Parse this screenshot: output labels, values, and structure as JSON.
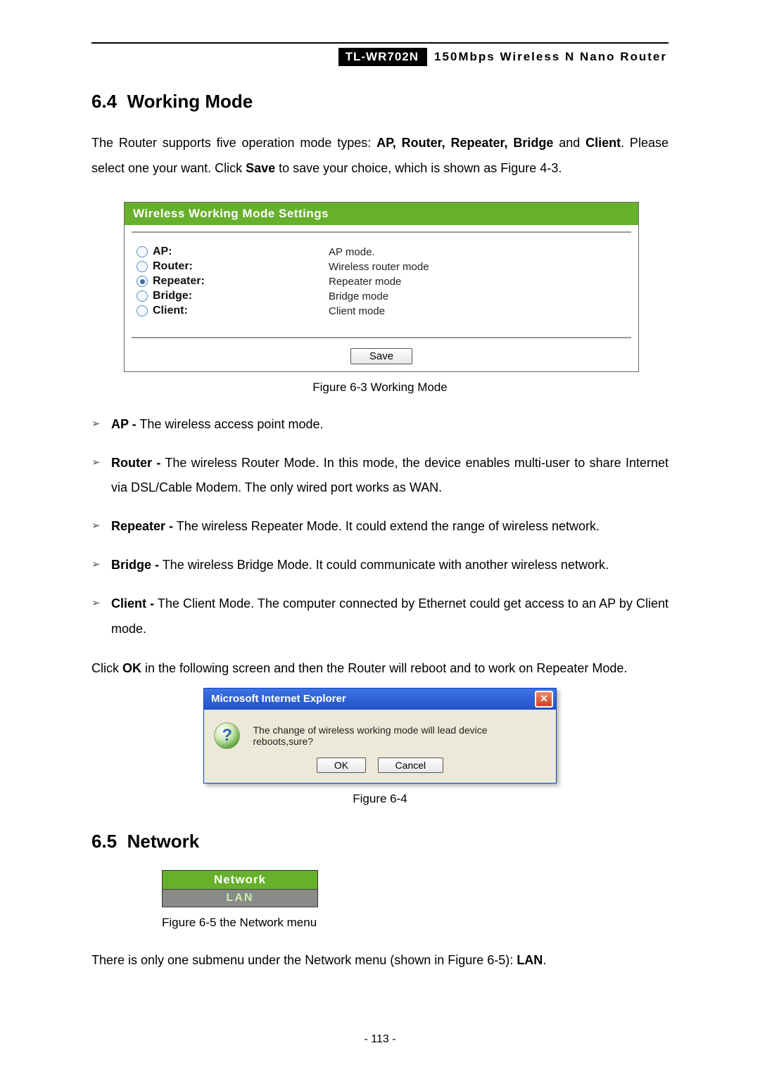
{
  "header": {
    "model": "TL-WR702N",
    "desc": "150Mbps Wireless N Nano Router"
  },
  "section64": {
    "num": "6.4",
    "title": "Working Mode",
    "intro_pre": "The Router supports five operation mode types: ",
    "intro_modes": "AP, Router, Repeater, Bridge",
    "intro_and": " and ",
    "intro_client": "Client",
    "intro_post": ". Please select one your want. Click ",
    "intro_save": "Save",
    "intro_tail": " to save your choice, which is shown as Figure 4-3."
  },
  "panel": {
    "title": "Wireless Working Mode Settings",
    "options": [
      {
        "label": "AP:",
        "desc": "AP mode.",
        "selected": false
      },
      {
        "label": "Router:",
        "desc": "Wireless router mode",
        "selected": false
      },
      {
        "label": "Repeater:",
        "desc": "Repeater mode",
        "selected": true
      },
      {
        "label": "Bridge:",
        "desc": "Bridge mode",
        "selected": false
      },
      {
        "label": "Client:",
        "desc": "Client mode",
        "selected": false
      }
    ],
    "save": "Save",
    "caption": "Figure 6-3 Working Mode"
  },
  "mode_list": [
    {
      "lead": "AP -",
      "text": " The wireless access point mode."
    },
    {
      "lead": "Router -",
      "text": " The wireless Router Mode. In this mode, the device enables multi-user to share Internet via DSL/Cable Modem. The only wired port works as WAN."
    },
    {
      "lead": "Repeater -",
      "text": " The wireless Repeater Mode. It could extend the range of wireless network."
    },
    {
      "lead": "Bridge -",
      "text": " The wireless Bridge Mode. It could communicate with another wireless network."
    },
    {
      "lead": "Client -",
      "text": " The Client Mode. The computer connected by Ethernet could get access to an AP by Client mode."
    }
  ],
  "after_list_pre": "Click ",
  "after_list_ok": "OK",
  "after_list_post": " in the following screen and then the Router will reboot and to work on Repeater Mode.",
  "dialog": {
    "title": "Microsoft Internet Explorer",
    "message": "The change of wireless working mode will lead device reboots,sure?",
    "ok": "OK",
    "cancel": "Cancel",
    "caption": "Figure 6-4"
  },
  "section65": {
    "num": "6.5",
    "title": "Network"
  },
  "netmenu": {
    "head": "Network",
    "item": "LAN",
    "caption": "Figure 6-5   the Network menu"
  },
  "net_para_pre": "There is only one submenu under the Network menu (shown in Figure 6-5): ",
  "net_para_lan": "LAN",
  "net_para_post": ".",
  "page_number": "- 113 -"
}
